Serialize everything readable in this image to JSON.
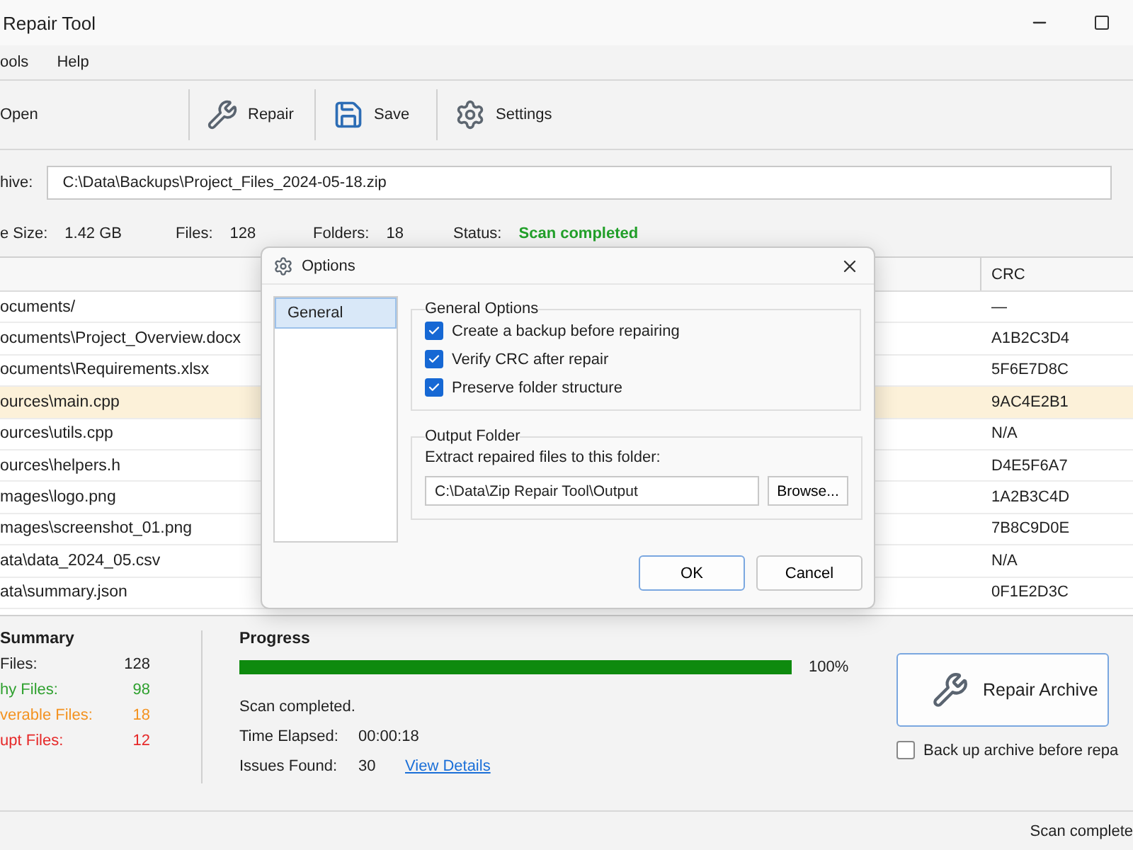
{
  "window": {
    "title": "Repair Tool"
  },
  "menu": [
    {
      "label": "ools"
    },
    {
      "label": "Help"
    }
  ],
  "toolbar": [
    {
      "label": "Open"
    },
    {
      "label": "Repair"
    },
    {
      "label": "Save"
    },
    {
      "label": "Settings"
    }
  ],
  "archive": {
    "label": "hive:",
    "value": "C:\\Data\\Backups\\Project_Files_2024-05-18.zip"
  },
  "info": [
    {
      "label": "e Size:",
      "value": "1.42 GB",
      "kind": "plain"
    },
    {
      "label": "Files:",
      "value": "128",
      "kind": "plain"
    },
    {
      "label": "Folders:",
      "value": "18",
      "kind": "plain"
    },
    {
      "label": "Status:",
      "value": "Scan completed",
      "kind": "status"
    }
  ],
  "table": {
    "columns": [
      "CRC"
    ],
    "rows": [
      {
        "column_1": "ocuments/",
        "crc": "—",
        "selected": false
      },
      {
        "column_1": "ocuments\\Project_Overview.docx",
        "crc": "A1B2C3D4",
        "selected": false
      },
      {
        "column_1": "ocuments\\Requirements.xlsx",
        "crc": "5F6E7D8C",
        "selected": false
      },
      {
        "column_1": "ources\\main.cpp",
        "crc": "9AC4E2B1",
        "selected": true
      },
      {
        "column_1": "ources\\utils.cpp",
        "crc": "N/A",
        "selected": false
      },
      {
        "column_1": "ources\\helpers.h",
        "crc": "D4E5F6A7",
        "selected": false
      },
      {
        "column_1": "mages\\logo.png",
        "crc": "1A2B3C4D",
        "selected": false
      },
      {
        "column_1": "mages\\screenshot_01.png",
        "crc": "7B8C9D0E",
        "selected": false
      },
      {
        "column_1": "ata\\data_2024_05.csv",
        "crc": "N/A",
        "selected": false
      },
      {
        "column_1": "ata\\summary.json",
        "crc": "0F1E2D3C",
        "selected": false
      }
    ]
  },
  "summary": {
    "title": "Summary",
    "items": [
      {
        "label": "Files:",
        "value": "128",
        "color": "#222222"
      },
      {
        "label": "hy Files:",
        "value": "98",
        "color": "#2ea02e"
      },
      {
        "label": "verable Files:",
        "value": "18",
        "color": "#f39220"
      },
      {
        "label": "upt Files:",
        "value": "12",
        "color": "#e62828"
      }
    ]
  },
  "progress": {
    "title": "Progress",
    "level": 1,
    "reading": "100%",
    "message": "Scan completed.",
    "stats": [
      {
        "label": "Time Elapsed:",
        "value": "00:00:18"
      },
      {
        "label": "Issues Found:",
        "value": "30",
        "link": "View Details"
      }
    ]
  },
  "repair_button": {
    "label": "Repair Archive"
  },
  "backup_checkbox": {
    "label": "Back up archive before repa",
    "checked": false
  },
  "status_bar": {
    "text": "Scan complete"
  },
  "dialog": {
    "title": "Options",
    "nav": [
      {
        "label": "General",
        "selected": true
      }
    ],
    "general_group": {
      "title": "General Options",
      "options": [
        {
          "label": "Create a backup before repairing",
          "checked": true
        },
        {
          "label": "Verify CRC after repair",
          "checked": true
        },
        {
          "label": "Preserve folder structure",
          "checked": true
        }
      ]
    },
    "output_group": {
      "title": "Output Folder",
      "hint": "Extract repaired files to this folder:",
      "value": "C:\\Data\\Zip Repair Tool\\Output",
      "browse": "Browse..."
    },
    "buttons": [
      {
        "label": "OK",
        "kind": "default"
      },
      {
        "label": "Cancel",
        "kind": "normal"
      }
    ]
  }
}
